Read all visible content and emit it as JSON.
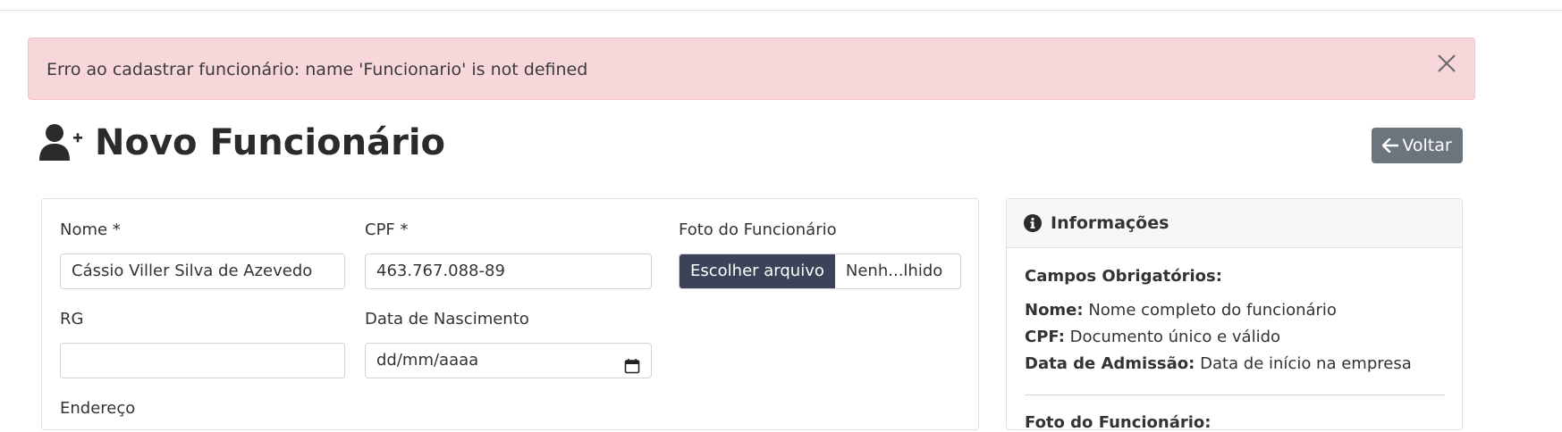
{
  "alert": {
    "message": "Erro ao cadastrar funcionário: name 'Funcionario' is not defined",
    "close_icon": "close-icon"
  },
  "header": {
    "title": "Novo Funcionário",
    "title_icon": "user-plus-icon",
    "back_label": "Voltar",
    "back_icon": "arrow-left-icon"
  },
  "form": {
    "nome_label": "Nome *",
    "nome_value": "Cássio Viller Silva de Azevedo",
    "cpf_label": "CPF *",
    "cpf_value": "463.767.088-89",
    "foto_label": "Foto do Funcionário",
    "foto_button": "Escolher arquivo",
    "foto_filename": "Nenh...lhido",
    "rg_label": "RG",
    "rg_value": "",
    "nascimento_label": "Data de Nascimento",
    "nascimento_placeholder": "dd/mm/aaaa",
    "endereco_label": "Endereço"
  },
  "info": {
    "title": "Informações",
    "icon": "info-circle-icon",
    "required_heading": "Campos Obrigatórios:",
    "items": [
      {
        "key": "Nome:",
        "text": "Nome completo do funcionário"
      },
      {
        "key": "CPF:",
        "text": "Documento único e válido"
      },
      {
        "key": "Data de Admissão:",
        "text": "Data de início na empresa"
      }
    ],
    "foto_heading": "Foto do Funcionário:"
  },
  "colors": {
    "alert_bg": "#f8d7da",
    "back_button": "#6c757d",
    "file_button": "#3a4358"
  }
}
